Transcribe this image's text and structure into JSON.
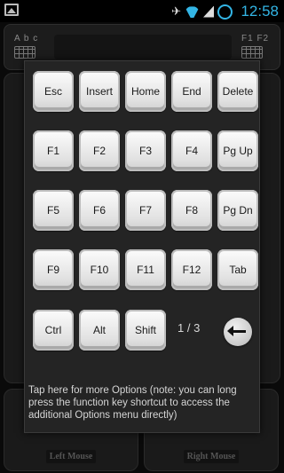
{
  "status_bar": {
    "time": "12:58",
    "icons": [
      "image-notification-icon",
      "mute-icon",
      "wifi-icon",
      "signal-icon",
      "sync-ring-icon"
    ]
  },
  "background_app": {
    "left_keyboard_label": "A b c",
    "right_keyboard_label": "F1 F2",
    "left_mouse_label": "Left Mouse",
    "right_mouse_label": "Right Mouse"
  },
  "keys": {
    "row1": [
      "Esc",
      "Insert",
      "Home",
      "End",
      "Delete"
    ],
    "row2": [
      "F1",
      "F2",
      "F3",
      "F4",
      "Pg Up"
    ],
    "row3": [
      "F5",
      "F6",
      "F7",
      "F8",
      "Pg Dn"
    ],
    "row4": [
      "F9",
      "F10",
      "F11",
      "F12",
      "Tab"
    ],
    "row5": [
      "Ctrl",
      "Alt",
      "Shift"
    ]
  },
  "page_indicator": "1 / 3",
  "more_options_text": "Tap here for more Options (note: you can long press the function key shortcut to access the additional Options menu directly)",
  "colors": {
    "accent": "#33b5e5",
    "key_face": "#eeeeee",
    "popup_bg": "#242424"
  }
}
